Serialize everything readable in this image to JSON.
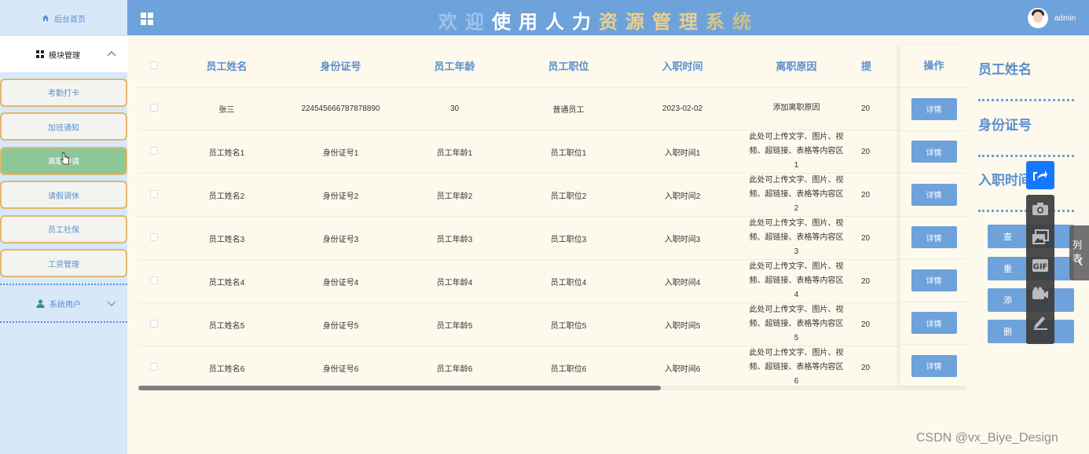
{
  "sidebar": {
    "home_label": "后台首页",
    "module_label": "模块管理",
    "menu": [
      {
        "label": "考勤打卡"
      },
      {
        "label": "加班通知"
      },
      {
        "label": "离职申请"
      },
      {
        "label": "请假调休"
      },
      {
        "label": "员工社保"
      },
      {
        "label": "工资管理"
      }
    ],
    "users_label": "系统用户"
  },
  "header": {
    "title_chars": [
      "欢",
      "迎",
      "使",
      "用",
      "人",
      "力",
      "资",
      "源",
      "管",
      "理",
      "系",
      "统"
    ],
    "title_colors": [
      "#9dc4ec",
      "#9dc4ec",
      "#ffffff",
      "#ffffff",
      "#ffffff",
      "#ffffff",
      "#e9d08f",
      "#e9d08f",
      "#e9d08f",
      "#e9d08f",
      "#d8c88a",
      "#c9c08a"
    ],
    "user": "admin"
  },
  "table": {
    "columns": [
      "员工姓名",
      "身份证号",
      "员工年龄",
      "员工职位",
      "入职时间",
      "离职原因",
      "提"
    ],
    "op_header": "操作",
    "detail_label": "详情",
    "rows": [
      {
        "name": "张三",
        "id": "224545666787878890",
        "age": "30",
        "position": "普通员工",
        "date": "2023-02-02",
        "reason": "添加离职原因",
        "extra": "20"
      },
      {
        "name": "员工姓名1",
        "id": "身份证号1",
        "age": "员工年龄1",
        "position": "员工职位1",
        "date": "入职时间1",
        "reason": "此处可上传文字、图片、视频、超链接、表格等内容区1",
        "extra": "20"
      },
      {
        "name": "员工姓名2",
        "id": "身份证号2",
        "age": "员工年龄2",
        "position": "员工职位2",
        "date": "入职时间2",
        "reason": "此处可上传文字、图片、视频、超链接、表格等内容区2",
        "extra": "20"
      },
      {
        "name": "员工姓名3",
        "id": "身份证号3",
        "age": "员工年龄3",
        "position": "员工职位3",
        "date": "入职时间3",
        "reason": "此处可上传文字、图片、视频、超链接、表格等内容区3",
        "extra": "20"
      },
      {
        "name": "员工姓名4",
        "id": "身份证号4",
        "age": "员工年龄4",
        "position": "员工职位4",
        "date": "入职时间4",
        "reason": "此处可上传文字、图片、视频、超链接、表格等内容区4",
        "extra": "20"
      },
      {
        "name": "员工姓名5",
        "id": "身份证号5",
        "age": "员工年龄5",
        "position": "员工职位5",
        "date": "入职时间5",
        "reason": "此处可上传文字、图片、视频、超链接、表格等内容区5",
        "extra": "20"
      },
      {
        "name": "员工姓名6",
        "id": "身份证号6",
        "age": "员工年龄6",
        "position": "员工职位6",
        "date": "入职时间6",
        "reason": "此处可上传文字、图片、视频、超链接、表格等内容区6",
        "extra": "20"
      }
    ],
    "scroll_fraction": 0.63
  },
  "search": {
    "labels": [
      "员工姓名",
      "身份证号",
      "入职时间"
    ],
    "buttons": [
      "查",
      "重",
      "添",
      "删"
    ]
  },
  "overlay": {
    "side_tab_label": "列表",
    "icons": [
      "share-icon",
      "camera-icon",
      "screenshot-icon",
      "gif-icon",
      "video-icon",
      "pen-icon"
    ]
  },
  "watermark": "CSDN @vx_Biye_Design"
}
